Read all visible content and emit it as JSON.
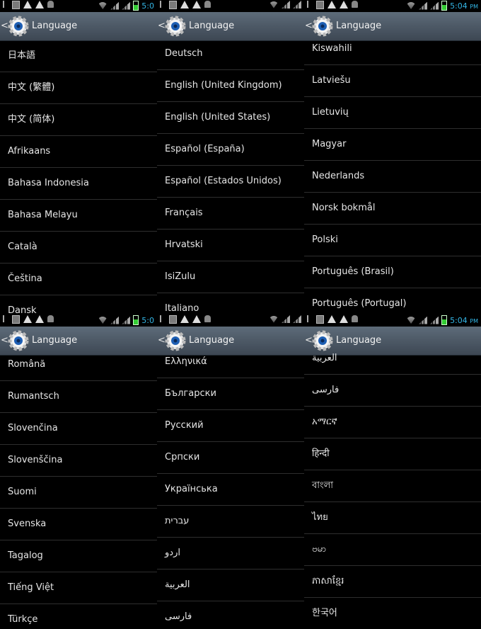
{
  "title": "Language",
  "panels": [
    {
      "clock": "5:0",
      "clock_suffix": "",
      "items": [
        "日本語",
        "中文 (繁體)",
        "中文 (简体)",
        "Afrikaans",
        "Bahasa Indonesia",
        "Bahasa Melayu",
        "Català",
        "Čeština",
        "Dansk"
      ]
    },
    {
      "clock": "",
      "clock_suffix": "",
      "items": [
        "Deutsch",
        "English (United Kingdom)",
        "English (United States)",
        "Español (España)",
        "Español (Estados Unidos)",
        "Français",
        "Hrvatski",
        "IsiZulu",
        "Italiano"
      ]
    },
    {
      "clock": "5:04",
      "clock_suffix": "PM",
      "items": [
        "Kiswahili",
        "Latviešu",
        "Lietuvių",
        "Magyar",
        "Nederlands",
        "Norsk bokmål",
        "Polski",
        "Português (Brasil)",
        "Português (Portugal)"
      ]
    },
    {
      "clock": "5:0",
      "clock_suffix": "",
      "items": [
        "Română",
        "Rumantsch",
        "Slovenčina",
        "Slovenščina",
        "Suomi",
        "Svenska",
        "Tagalog",
        "Tiếng Việt",
        "Türkçe"
      ]
    },
    {
      "clock": "",
      "clock_suffix": "",
      "items": [
        "Ελληνικά",
        "Български",
        "Русский",
        "Српски",
        "Українська",
        "עברית",
        "اردو",
        "العربية",
        "فارسی"
      ]
    },
    {
      "clock": "5:04",
      "clock_suffix": "PM",
      "items": [
        "العربية",
        "فارسی",
        "አማርኛ",
        "हिन्दी",
        "বাংলা",
        "ไทย",
        "ဗမာ",
        "ភាសាខ្មែរ",
        "한국어"
      ]
    }
  ],
  "colors": {
    "actionbar": "#4a5563",
    "clock": "#33b5e5",
    "divider": "#2e2e2e",
    "text": "#e6e6e6"
  }
}
